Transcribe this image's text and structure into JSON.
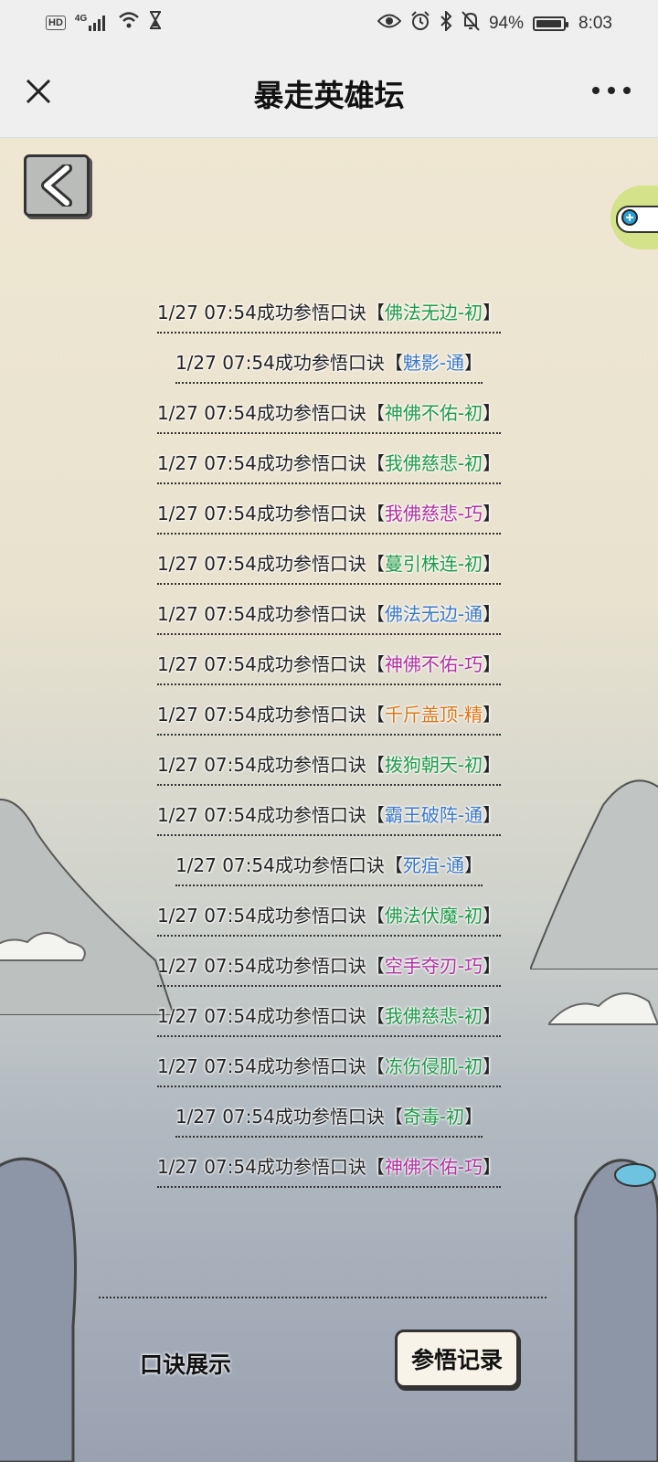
{
  "status_bar": {
    "hd": "HD",
    "network": "4G",
    "battery": "94%",
    "time": "8:03",
    "icons": [
      "signal-icon",
      "wifi-icon",
      "hourglass-icon",
      "eye-icon",
      "alarm-icon",
      "bluetooth-icon",
      "mute-icon",
      "battery-icon"
    ]
  },
  "nav": {
    "title": "暴走英雄坛",
    "close_icon": "close-icon",
    "more_icon": "more-icon"
  },
  "records": [
    {
      "prefix": "1/27 07:54成功参悟口诀",
      "lb": "【",
      "skill": "佛法无边-初",
      "rb": "】",
      "tier": "chu"
    },
    {
      "prefix": "1/27 07:54成功参悟口诀",
      "lb": "【",
      "skill": "魅影-通",
      "rb": "】",
      "tier": "tong"
    },
    {
      "prefix": "1/27 07:54成功参悟口诀",
      "lb": "【",
      "skill": "神佛不佑-初",
      "rb": "】",
      "tier": "chu"
    },
    {
      "prefix": "1/27 07:54成功参悟口诀",
      "lb": "【",
      "skill": "我佛慈悲-初",
      "rb": "】",
      "tier": "chu"
    },
    {
      "prefix": "1/27 07:54成功参悟口诀",
      "lb": "【",
      "skill": "我佛慈悲-巧",
      "rb": "】",
      "tier": "qiao"
    },
    {
      "prefix": "1/27 07:54成功参悟口诀",
      "lb": "【",
      "skill": "蔓引株连-初",
      "rb": "】",
      "tier": "chu"
    },
    {
      "prefix": "1/27 07:54成功参悟口诀",
      "lb": "【",
      "skill": "佛法无边-通",
      "rb": "】",
      "tier": "tong"
    },
    {
      "prefix": "1/27 07:54成功参悟口诀",
      "lb": "【",
      "skill": "神佛不佑-巧",
      "rb": "】",
      "tier": "qiao"
    },
    {
      "prefix": "1/27 07:54成功参悟口诀",
      "lb": "【",
      "skill": "千斤盖顶-精",
      "rb": "】",
      "tier": "jing"
    },
    {
      "prefix": "1/27 07:54成功参悟口诀",
      "lb": "【",
      "skill": "拨狗朝天-初",
      "rb": "】",
      "tier": "chu"
    },
    {
      "prefix": "1/27 07:54成功参悟口诀",
      "lb": "【",
      "skill": "霸王破阵-通",
      "rb": "】",
      "tier": "tong"
    },
    {
      "prefix": "1/27 07:54成功参悟口诀",
      "lb": "【",
      "skill": "死疽-通",
      "rb": "】",
      "tier": "tong"
    },
    {
      "prefix": "1/27 07:54成功参悟口诀",
      "lb": "【",
      "skill": "佛法伏魔-初",
      "rb": "】",
      "tier": "chu"
    },
    {
      "prefix": "1/27 07:54成功参悟口诀",
      "lb": "【",
      "skill": "空手夺刃-巧",
      "rb": "】",
      "tier": "qiao"
    },
    {
      "prefix": "1/27 07:54成功参悟口诀",
      "lb": "【",
      "skill": "我佛慈悲-初",
      "rb": "】",
      "tier": "chu"
    },
    {
      "prefix": "1/27 07:54成功参悟口诀",
      "lb": "【",
      "skill": "冻伤侵肌-初",
      "rb": "】",
      "tier": "chu"
    },
    {
      "prefix": "1/27 07:54成功参悟口诀",
      "lb": "【",
      "skill": "奇毒-初",
      "rb": "】",
      "tier": "chu"
    },
    {
      "prefix": "1/27 07:54成功参悟口诀",
      "lb": "【",
      "skill": "神佛不佑-巧",
      "rb": "】",
      "tier": "qiao"
    }
  ],
  "tier_colors": {
    "chu": "#1f9a48",
    "tong": "#3b77c4",
    "qiao": "#b0319f",
    "jing": "#e07414"
  },
  "bottom_tabs": {
    "display": "口诀展示",
    "records": "参悟记录"
  }
}
